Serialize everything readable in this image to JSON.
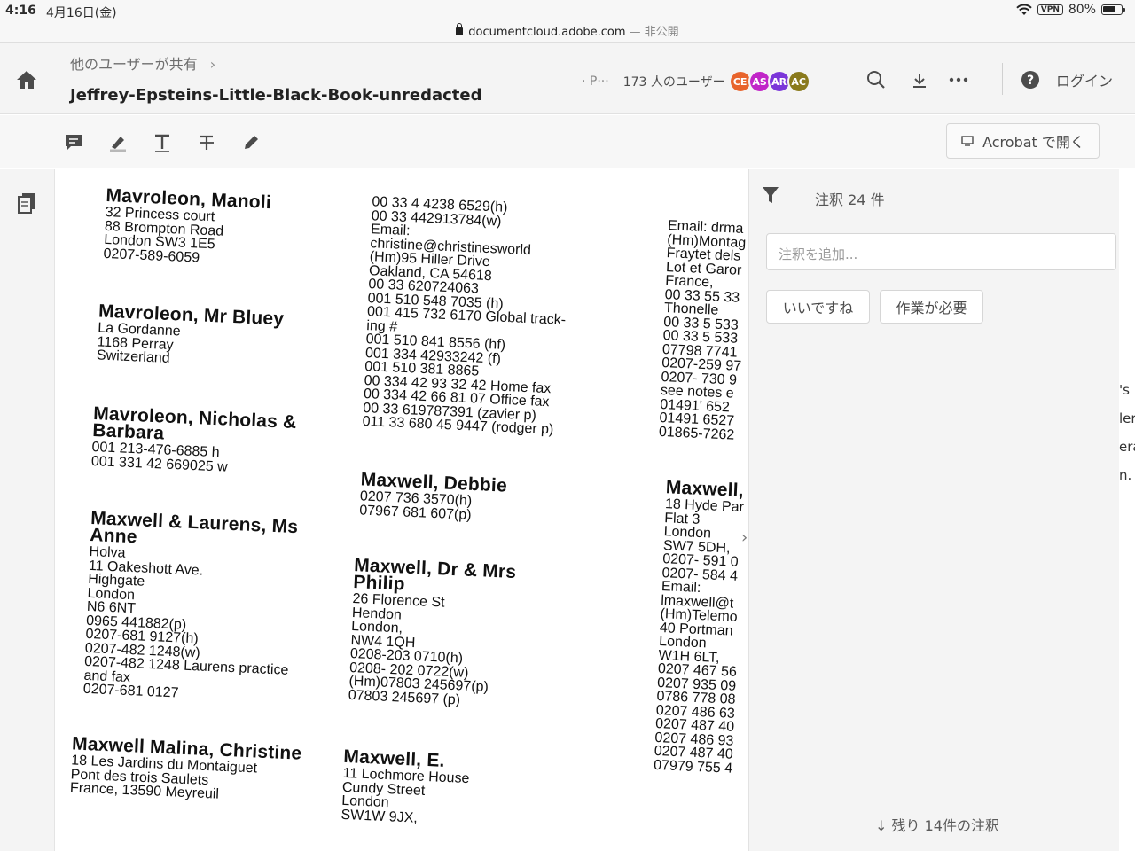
{
  "status_bar": {
    "time": "4:16",
    "date": "4月16日(金)",
    "url": "documentcloud.adobe.com",
    "privacy": "— 非公開",
    "vpn": "VPN",
    "battery": "80%",
    "battery_level": 0.8
  },
  "header": {
    "breadcrumb": "他のユーザーが共有",
    "title": "Jeffrey-Epsteins-Little-Black-Book-unredacted",
    "share_prefix": "· P···",
    "user_count": "173 人のユーザー",
    "avatars": [
      {
        "initials": "CE",
        "color": "#e8642c"
      },
      {
        "initials": "AS",
        "color": "#c125c8"
      },
      {
        "initials": "AR",
        "color": "#7b36d9"
      },
      {
        "initials": "AC",
        "color": "#8a7a1c"
      }
    ],
    "login": "ログイン"
  },
  "toolbar": {
    "open_acrobat": "Acrobat で開く"
  },
  "document": {
    "entries": [
      {
        "name": "Mavroleon, Manoli",
        "lines": "32 Princess court\n88 Brompton Road\nLondon  SW3 1E5\n0207-589-6059"
      },
      {
        "name": "Mavroleon, Mr Bluey",
        "lines": "La Gordanne\n1168 Perray\nSwitzerland"
      },
      {
        "name": "Mavroleon, Nicholas &\nBarbara",
        "lines": "001 213-476-6885 h\n001 331 42 669025 w"
      },
      {
        "name": "Maxwell & Laurens, Ms\nAnne",
        "lines": "Holva\n11 Oakeshott Ave.\nHighgate\nLondon\nN6 6NT\n0965 441882(p)\n0207-681 9127(h)\n0207-482 1248(w)\n0207-482 1248 Laurens practice\nand fax\n0207-681 0127"
      },
      {
        "name": "Maxwell Malina, Christine",
        "lines": "18 Les Jardins du Montaiguet\nPont des trois Saulets\nFrance, 13590 Meyreuil"
      },
      {
        "name": "",
        "lines": "00 33 4 4238 6529(h)\n00 33 442913784(w)\nEmail:\nchristine@christinesworld\n(Hm)95 Hiller  Drive\nOakland, CA  54618\n00 33 620724063\n001 510 548 7035 (h)\n001 415 732 6170 Global track-\ning #\n001 510 841 8556 (hf)\n001 334 42933242 (f)\n001 510 381 8865\n00 334 42 93 32 42 Home fax\n00 334 42 66 81 07 Office fax\n00 33 619787391 (zavier p)\n011 33 680 45 9447 (rodger p)"
      },
      {
        "name": "Maxwell, Debbie",
        "lines": "0207 736 3570(h)\n07967 681 607(p)"
      },
      {
        "name": "Maxwell, Dr & Mrs\nPhilip",
        "lines": "26 Florence St\nHendon\nLondon,\nNW4 1QH\n0208-203 0710(h)\n0208- 202 0722(w)\n(Hm)07803 245697(p)\n07803 245697 (p)"
      },
      {
        "name": "Maxwell, E.",
        "lines": "11 Lochmore House\nCundy Street\nLondon\nSW1W 9JX,"
      },
      {
        "name": "",
        "lines": "Email: drma\n(Hm)Montag\nFraytet dels\nLot et Garor\nFrance,\n00 33 55 33\nThonelle\n00 33 5 533\n00 33 5 533\n07798 7741\n0207-259 97\n0207- 730 9\nsee notes e\n 01491' 652\n 01491 6527\n01865-7262"
      },
      {
        "name": "Maxwell,",
        "lines": "18 Hyde Par\nFlat 3\nLondon\nSW7 5DH,\n0207- 591 0\n0207- 584 4\nEmail:\nlmaxwell@t\n(Hm)Telemo\n40 Portman\nLondon\nW1H  6LT,\n0207 467 56\n0207 935 09\n0786 778 08\n0207 486 63\n0207 487 40\n0207 486 93\n0207 487 40\n07979 755 4"
      }
    ]
  },
  "panel": {
    "comment_count": "注釈 24 件",
    "add_placeholder": "注釈を追加...",
    "chip_like": "いいですね",
    "chip_work": "作業が必要",
    "more": "残り 14件の注釈"
  },
  "sliver": [
    "'s",
    "ler",
    "era",
    "n."
  ]
}
